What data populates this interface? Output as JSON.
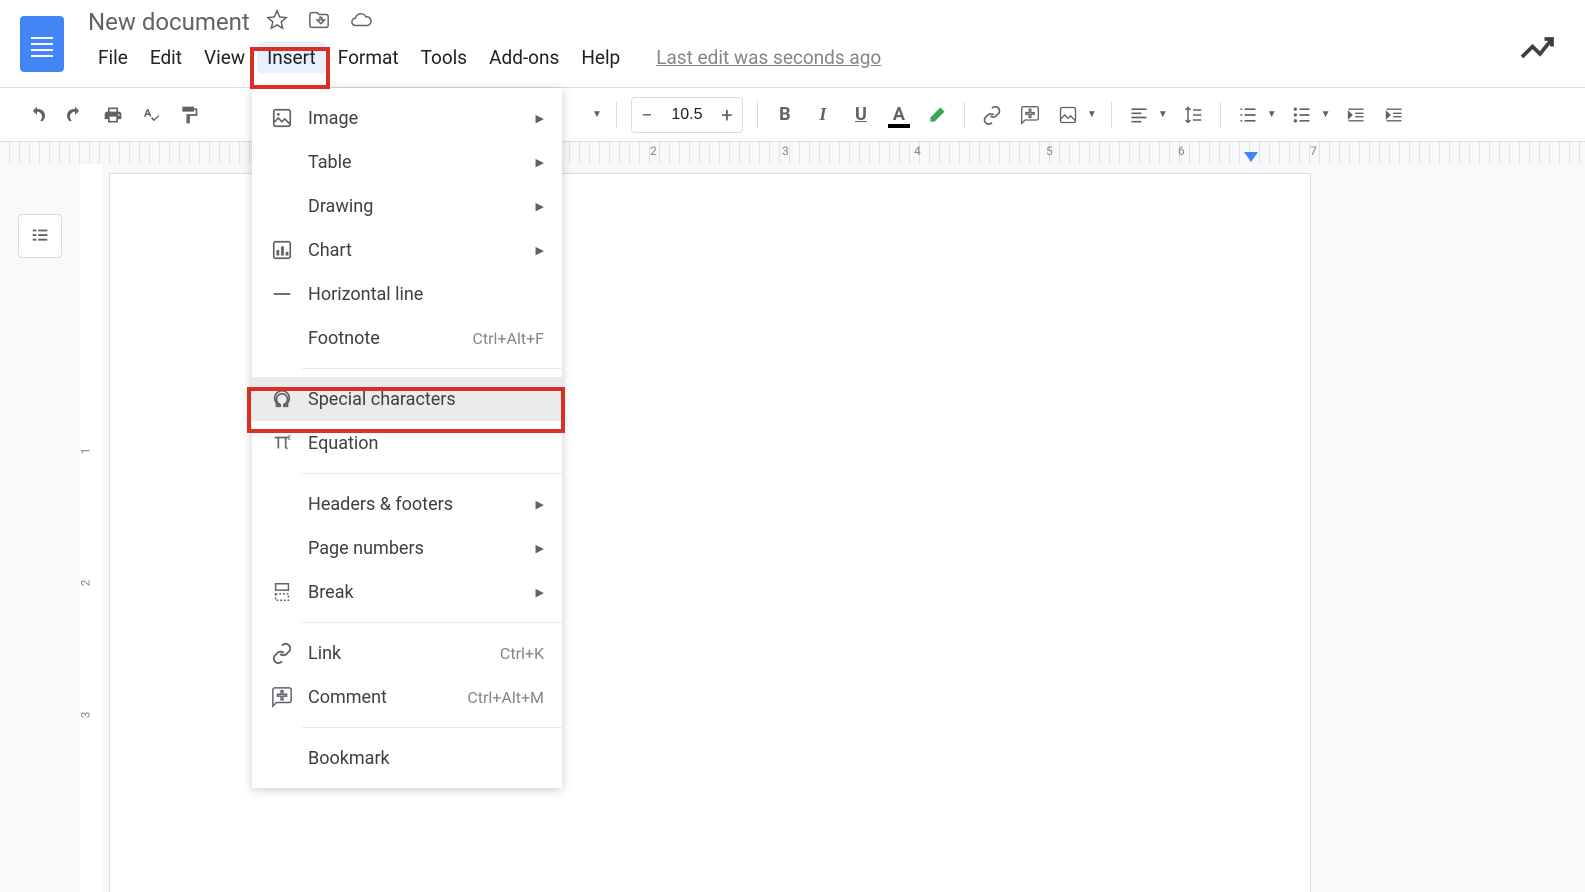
{
  "title": "New document",
  "last_edit": "Last edit was seconds ago",
  "menubar": {
    "file": "File",
    "edit": "Edit",
    "view": "View",
    "insert": "Insert",
    "format": "Format",
    "tools": "Tools",
    "addons": "Add-ons",
    "help": "Help"
  },
  "toolbar": {
    "font_size": "10.5"
  },
  "ruler": {
    "n2": "2",
    "n3": "3",
    "n4": "4",
    "n5": "5",
    "n6": "6",
    "n7": "7"
  },
  "vruler": {
    "n1": "1",
    "n2": "2",
    "n3": "3"
  },
  "insert_menu": {
    "image": "Image",
    "table": "Table",
    "drawing": "Drawing",
    "chart": "Chart",
    "horizontal_line": "Horizontal line",
    "footnote": "Footnote",
    "footnote_sc": "Ctrl+Alt+F",
    "special_chars": "Special characters",
    "equation": "Equation",
    "headers_footers": "Headers & footers",
    "page_numbers": "Page numbers",
    "break": "Break",
    "link": "Link",
    "link_sc": "Ctrl+K",
    "comment": "Comment",
    "comment_sc": "Ctrl+Alt+M",
    "bookmark": "Bookmark"
  }
}
